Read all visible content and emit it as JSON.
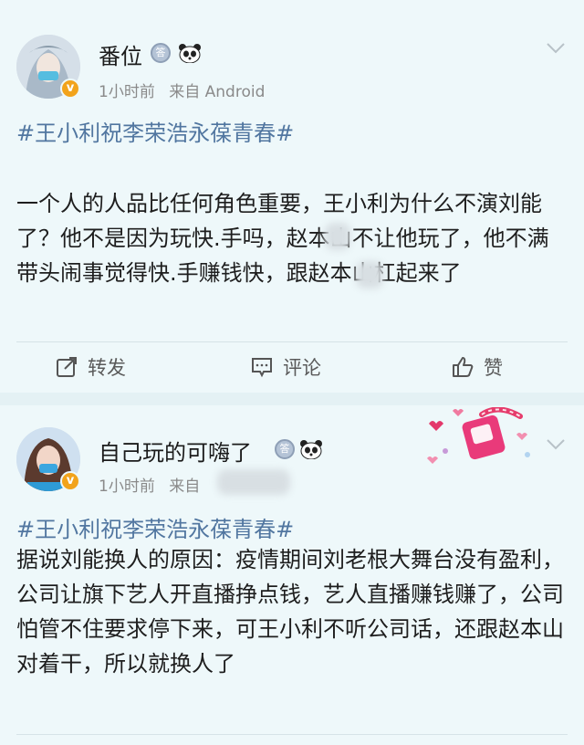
{
  "posts": [
    {
      "username": "番位",
      "time": "1小时前",
      "source_prefix": "来自",
      "source": "Android",
      "hashtag": "#王小利祝李荣浩永葆青春#",
      "text": "一个人的人品比任何角色重要，王小利为什么不演刘能了？他不是因为玩快.手吗，赵本山不让他玩了，他不满带头闹事觉得快.手赚钱快，跟赵本山杠起来了",
      "actions": {
        "repost": "转发",
        "comment": "评论",
        "like": "赞"
      }
    },
    {
      "username": "自己玩的可嗨了",
      "time": "1小时前",
      "source_prefix": "来自",
      "source": "",
      "hashtag": "#王小利祝李荣浩永葆青春#",
      "text": "据说刘能换人的原因：疫情期间刘老根大舞台没有盈利，公司让旗下艺人开直播挣点钱，艺人直播赚钱赚了，公司怕管不住要求停下来，可王小利不听公司话，还跟赵本山对着干，所以就换人了"
    }
  ],
  "badge_glyph": "答",
  "verified_glyph": "v",
  "colors": {
    "hashtag": "#5176a0",
    "verified": "#f2a31b",
    "background": "#eef8fa"
  }
}
